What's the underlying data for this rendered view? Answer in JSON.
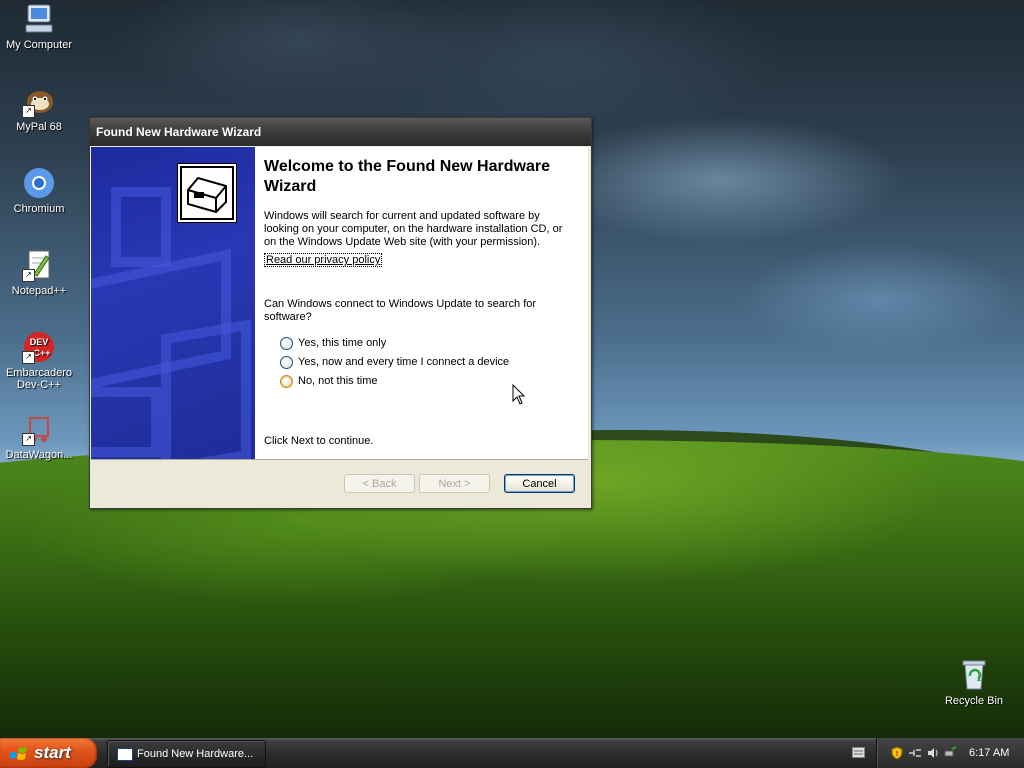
{
  "desktop": {
    "icons": [
      {
        "label": "My Computer",
        "icon": "my-computer-icon"
      },
      {
        "label": "MyPal 68",
        "icon": "mypal-icon"
      },
      {
        "label": "Chromium",
        "icon": "chromium-icon"
      },
      {
        "label": "Notepad++",
        "icon": "notepad-plus-plus-icon"
      },
      {
        "label": "Embarcadero\nDev-C++",
        "icon": "devcpp-icon"
      },
      {
        "label": "DataWagon...",
        "icon": "datawagon-icon"
      }
    ],
    "recycle_bin": {
      "label": "Recycle Bin",
      "icon": "recycle-bin-icon"
    }
  },
  "wizard": {
    "title": "Found New Hardware Wizard",
    "heading": "Welcome to the Found New Hardware Wizard",
    "description": "Windows will search for current and updated software by looking on your computer, on the hardware installation CD, or on the Windows Update Web site (with your permission).",
    "privacy_link": "Read our privacy policy",
    "question": "Can Windows connect to Windows Update to search for software?",
    "options": [
      {
        "label": "Yes, this time only",
        "selected": false
      },
      {
        "label": "Yes, now and every time I connect a device",
        "selected": false
      },
      {
        "label": "No, not this time",
        "selected": false
      }
    ],
    "footer_hint": "Click Next to continue.",
    "buttons": {
      "back": "< Back",
      "next": "Next >",
      "cancel": "Cancel"
    }
  },
  "taskbar": {
    "start_label": "start",
    "tasks": [
      {
        "label": "Found New Hardware..."
      }
    ],
    "clock": "6:17 AM",
    "tray_icons": [
      "security-shield-icon",
      "network-icon",
      "volume-icon",
      "safely-remove-hardware-icon"
    ]
  }
}
